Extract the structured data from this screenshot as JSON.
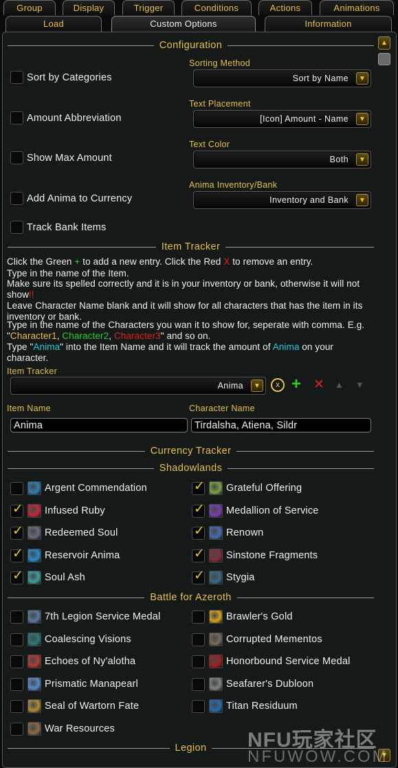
{
  "tabs_row1": [
    "Group",
    "Display",
    "Trigger",
    "Conditions",
    "Actions",
    "Animations"
  ],
  "tabs_row2": [
    "Load",
    "Custom Options",
    "Information"
  ],
  "sections": {
    "configuration": "Configuration",
    "item_tracker": "Item Tracker",
    "currency_tracker": "Currency Tracker",
    "shadowlands": "Shadowlands",
    "bfa": "Battle for Azeroth",
    "legion": "Legion"
  },
  "options": {
    "sort": {
      "label": "Sort by Categories",
      "dd_label": "Sorting Method",
      "dd_value": "Sort by Name"
    },
    "abbr": {
      "label": "Amount Abbreviation",
      "dd_label": "Text Placement",
      "dd_value": "[Icon] Amount - Name"
    },
    "max": {
      "label": "Show Max Amount",
      "dd_label": "Text Color",
      "dd_value": "Both"
    },
    "anima": {
      "label": "Add Anima to Currency",
      "dd_label": "Anima Inventory/Bank",
      "dd_value": "Inventory and Bank"
    },
    "bank": {
      "label": "Track Bank Items"
    }
  },
  "help": {
    "l1a": "Click the Green ",
    "plus": "+",
    "l1b": " to add a new entry. Click the Red ",
    "x": "X",
    "l1c": " to remove an entry.",
    "l2": "Type in the name of the Item.",
    "l3a": "Make sure its spelled correctly and it is in your inventory or bank, otherwise it will not show",
    "bang": "!!",
    "l4": "Leave Character Name blank and it will show for all characters that has the item in its inventory or bank.",
    "l5a": "Type in the name of the Characters you wan it to show for, seperate with comma. E.g. \"",
    "c1": "Character1",
    "comma": ", ",
    "c2": "Character2",
    "c3": "Character3",
    "l5b": "\" and so on.",
    "l6a": "Type \"",
    "anima": "Anima",
    "l6b": "\" into the Item Name and it will track the amount of ",
    "anima2": "Anima",
    "l6c": " on your character."
  },
  "tracker": {
    "label": "Item Tracker",
    "value": "Anima",
    "item_name_label": "Item Name",
    "item_name_value": "Anima",
    "char_name_label": "Character Name",
    "char_name_value": "Tirdalsha, Atiena, Sildr"
  },
  "shadowlands": [
    {
      "name": "Argent Commendation",
      "checked": false,
      "color": "#2f7fb8"
    },
    {
      "name": "Grateful Offering",
      "checked": true,
      "color": "#7aa24a"
    },
    {
      "name": "Infused Ruby",
      "checked": true,
      "color": "#c4283a"
    },
    {
      "name": "Medallion of Service",
      "checked": true,
      "color": "#7a3fb0"
    },
    {
      "name": "Redeemed Soul",
      "checked": true,
      "color": "#6a6a80"
    },
    {
      "name": "Renown",
      "checked": true,
      "color": "#4a6ab0"
    },
    {
      "name": "Reservoir Anima",
      "checked": true,
      "color": "#2a8ad0"
    },
    {
      "name": "Sinstone Fragments",
      "checked": true,
      "color": "#8a2a3a"
    },
    {
      "name": "Soul Ash",
      "checked": true,
      "color": "#3aa0a0"
    },
    {
      "name": "Stygia",
      "checked": true,
      "color": "#3a6a8a"
    }
  ],
  "bfa": [
    {
      "name": "7th Legion Service Medal",
      "checked": false,
      "color": "#5a7aa0"
    },
    {
      "name": "Brawler's Gold",
      "checked": false,
      "color": "#d4a020"
    },
    {
      "name": "Coalescing Visions",
      "checked": false,
      "color": "#2a7a7a"
    },
    {
      "name": "Corrupted Mementos",
      "checked": false,
      "color": "#7a6a5a"
    },
    {
      "name": "Echoes of Ny'alotha",
      "checked": false,
      "color": "#b03a3a"
    },
    {
      "name": "Honorbound Service Medal",
      "checked": false,
      "color": "#a02020"
    },
    {
      "name": "Prismatic Manapearl",
      "checked": false,
      "color": "#5a8ad0"
    },
    {
      "name": "Seafarer's Dubloon",
      "checked": false,
      "color": "#808080"
    },
    {
      "name": "Seal of Wartorn Fate",
      "checked": false,
      "color": "#b08a3a"
    },
    {
      "name": "Titan Residuum",
      "checked": false,
      "color": "#2a6ab0"
    },
    {
      "name": "War Resources",
      "checked": false,
      "color": "#8a6a4a"
    }
  ],
  "colors": {
    "accent": "#e8c04a",
    "green": "#2ecc2e",
    "red": "#e02020",
    "cyan": "#2ecadb"
  },
  "watermark": {
    "logo": "NFU玩家社区",
    "url": "NFUWOW.COM"
  }
}
